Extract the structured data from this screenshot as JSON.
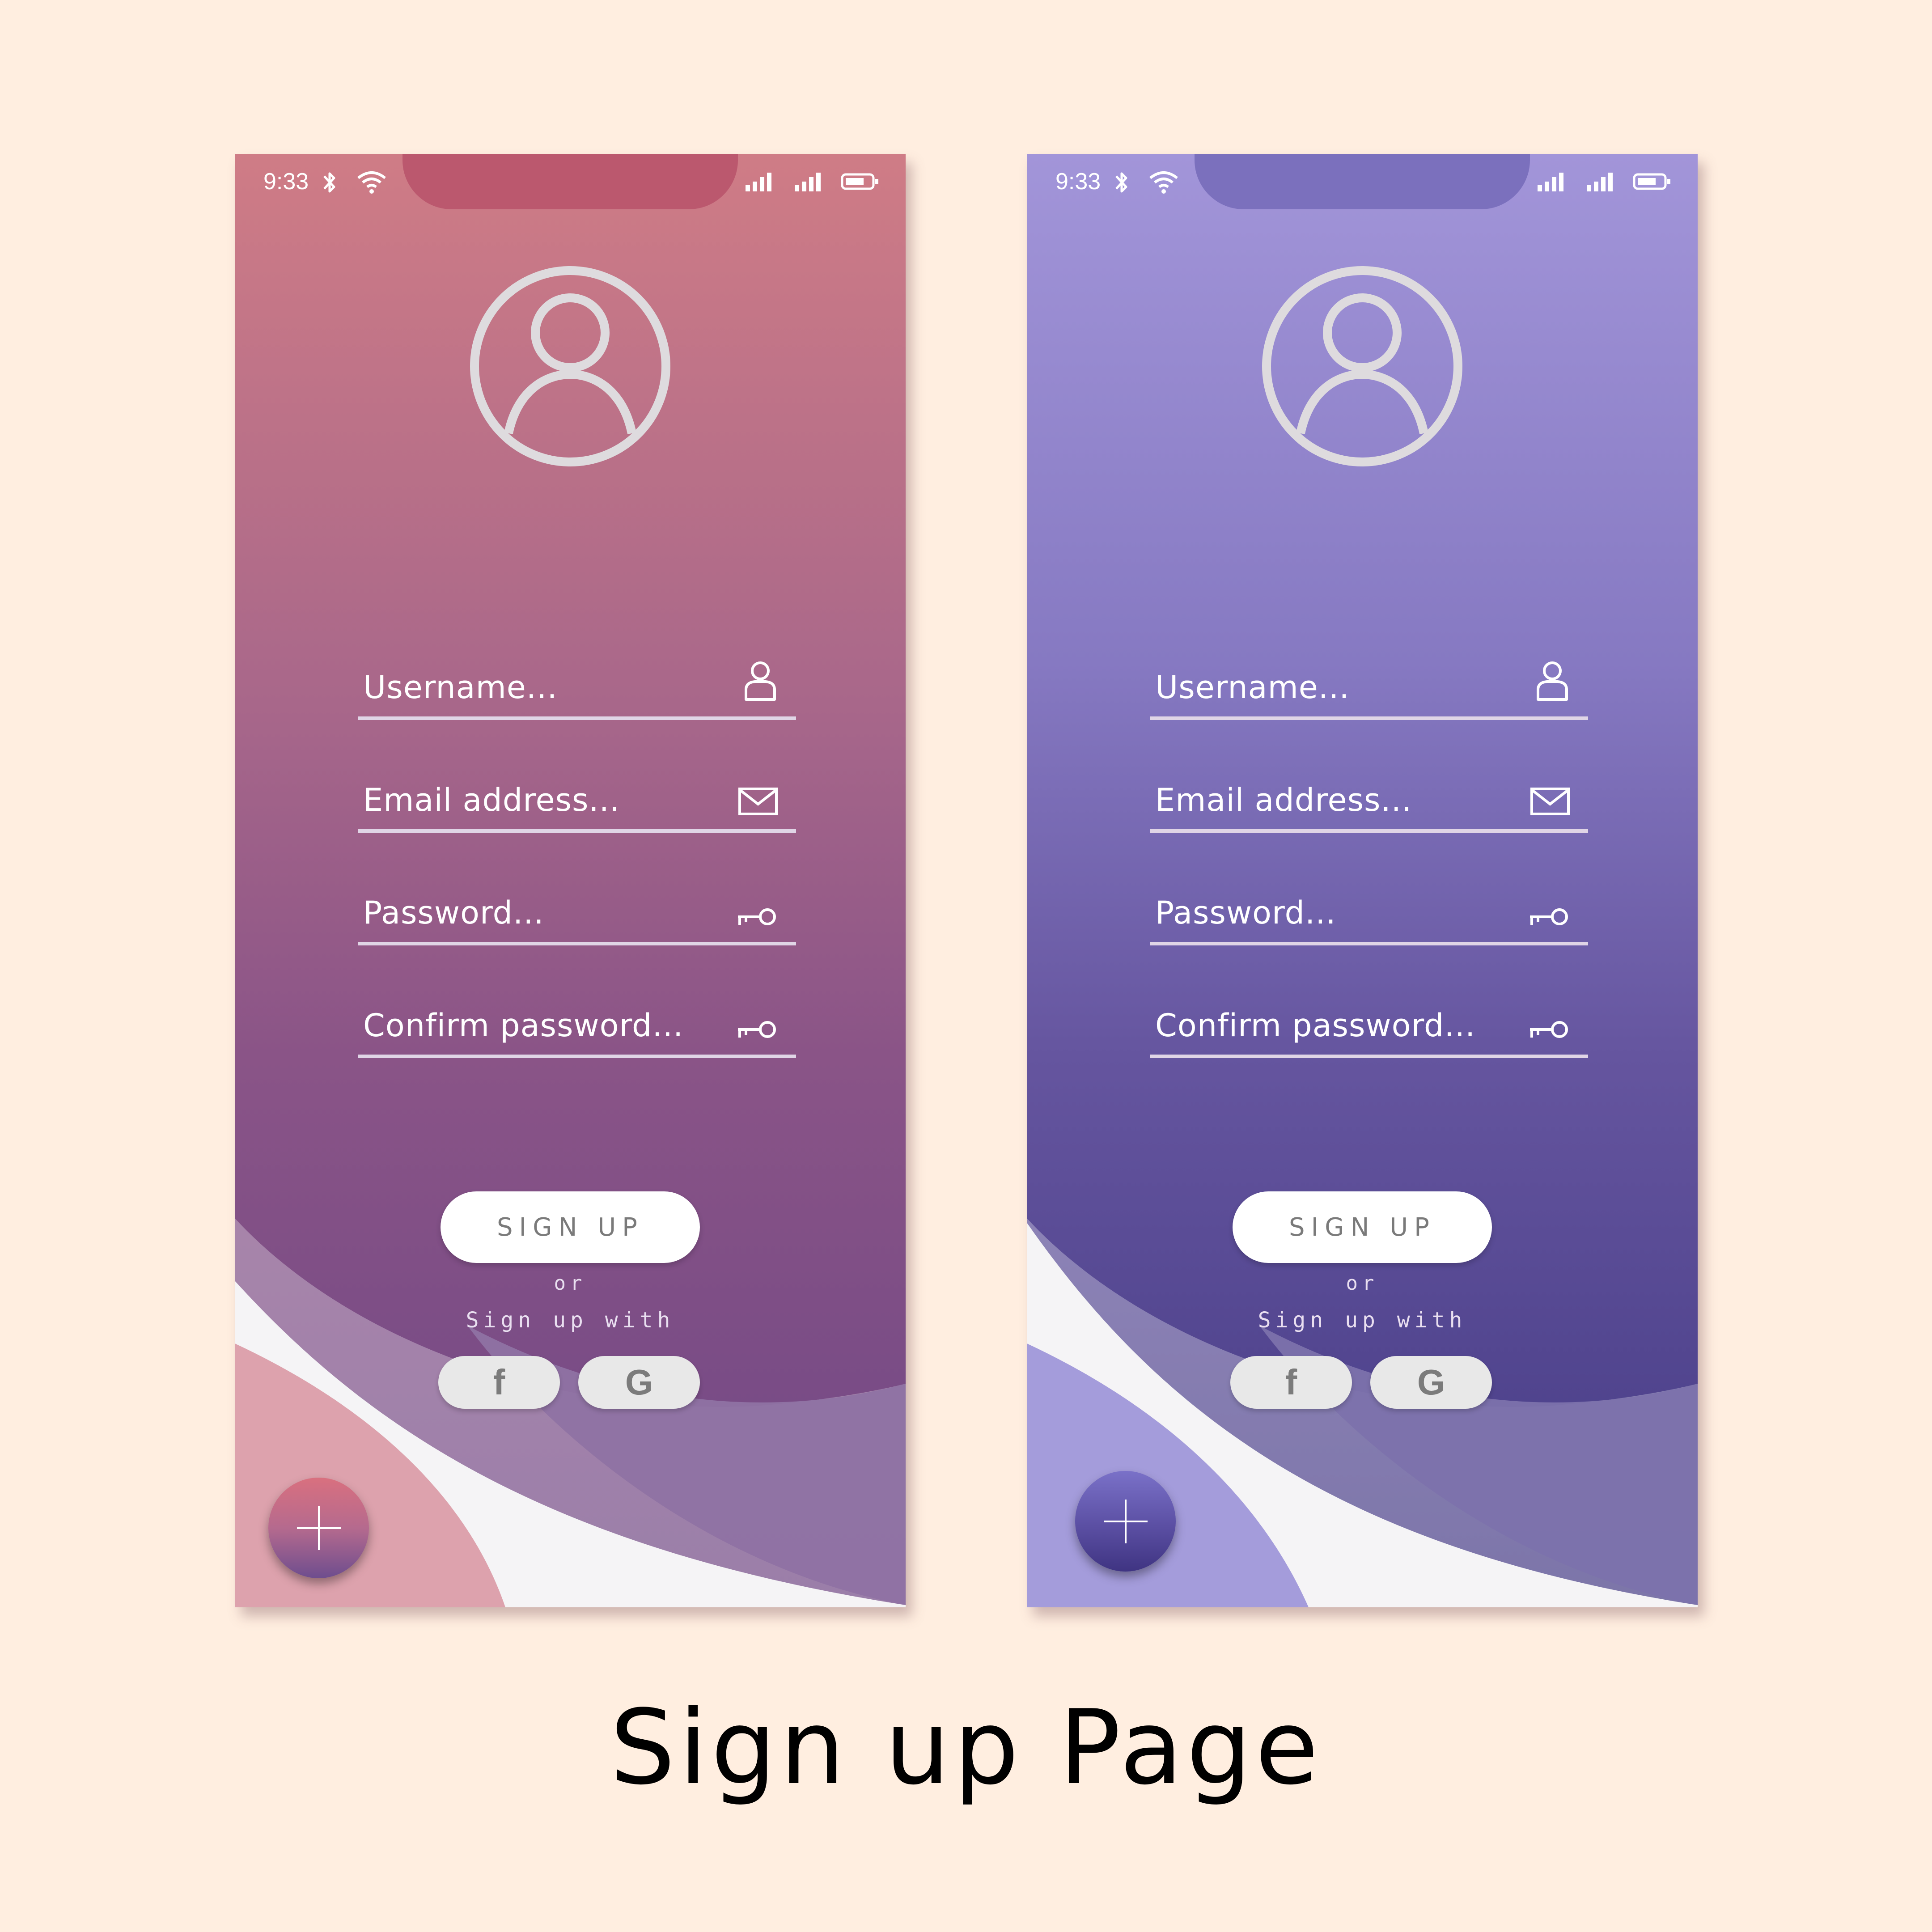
{
  "phones": [
    {
      "theme": "pink",
      "colors": {
        "top": "#CF7C86",
        "bottom": "#6F4785",
        "notch": "#BB586E"
      },
      "status": {
        "time": "9:33",
        "icons": [
          "bluetooth-icon",
          "wifi-icon",
          "signal-icon",
          "signal-icon",
          "battery-icon"
        ]
      },
      "fields": {
        "username": "Username...",
        "email": "Email address...",
        "password": "Password...",
        "confirm": "Confirm password..."
      },
      "signup_label": "SIGN UP",
      "or_text": "or",
      "signup_with_text": "Sign up with",
      "social": {
        "facebook": "f",
        "google": "G"
      }
    },
    {
      "theme": "purple",
      "colors": {
        "top": "#A295D9",
        "bottom": "#443A84",
        "notch": "#7B70BD"
      },
      "status": {
        "time": "9:33",
        "icons": [
          "bluetooth-icon",
          "wifi-icon",
          "signal-icon",
          "signal-icon",
          "battery-icon"
        ]
      },
      "fields": {
        "username": "Username...",
        "email": "Email address...",
        "password": "Password...",
        "confirm": "Confirm password..."
      },
      "signup_label": "SIGN UP",
      "or_text": "or",
      "signup_with_text": "Sign up with",
      "social": {
        "facebook": "f",
        "google": "G"
      }
    }
  ],
  "page_title": "Sign up Page"
}
